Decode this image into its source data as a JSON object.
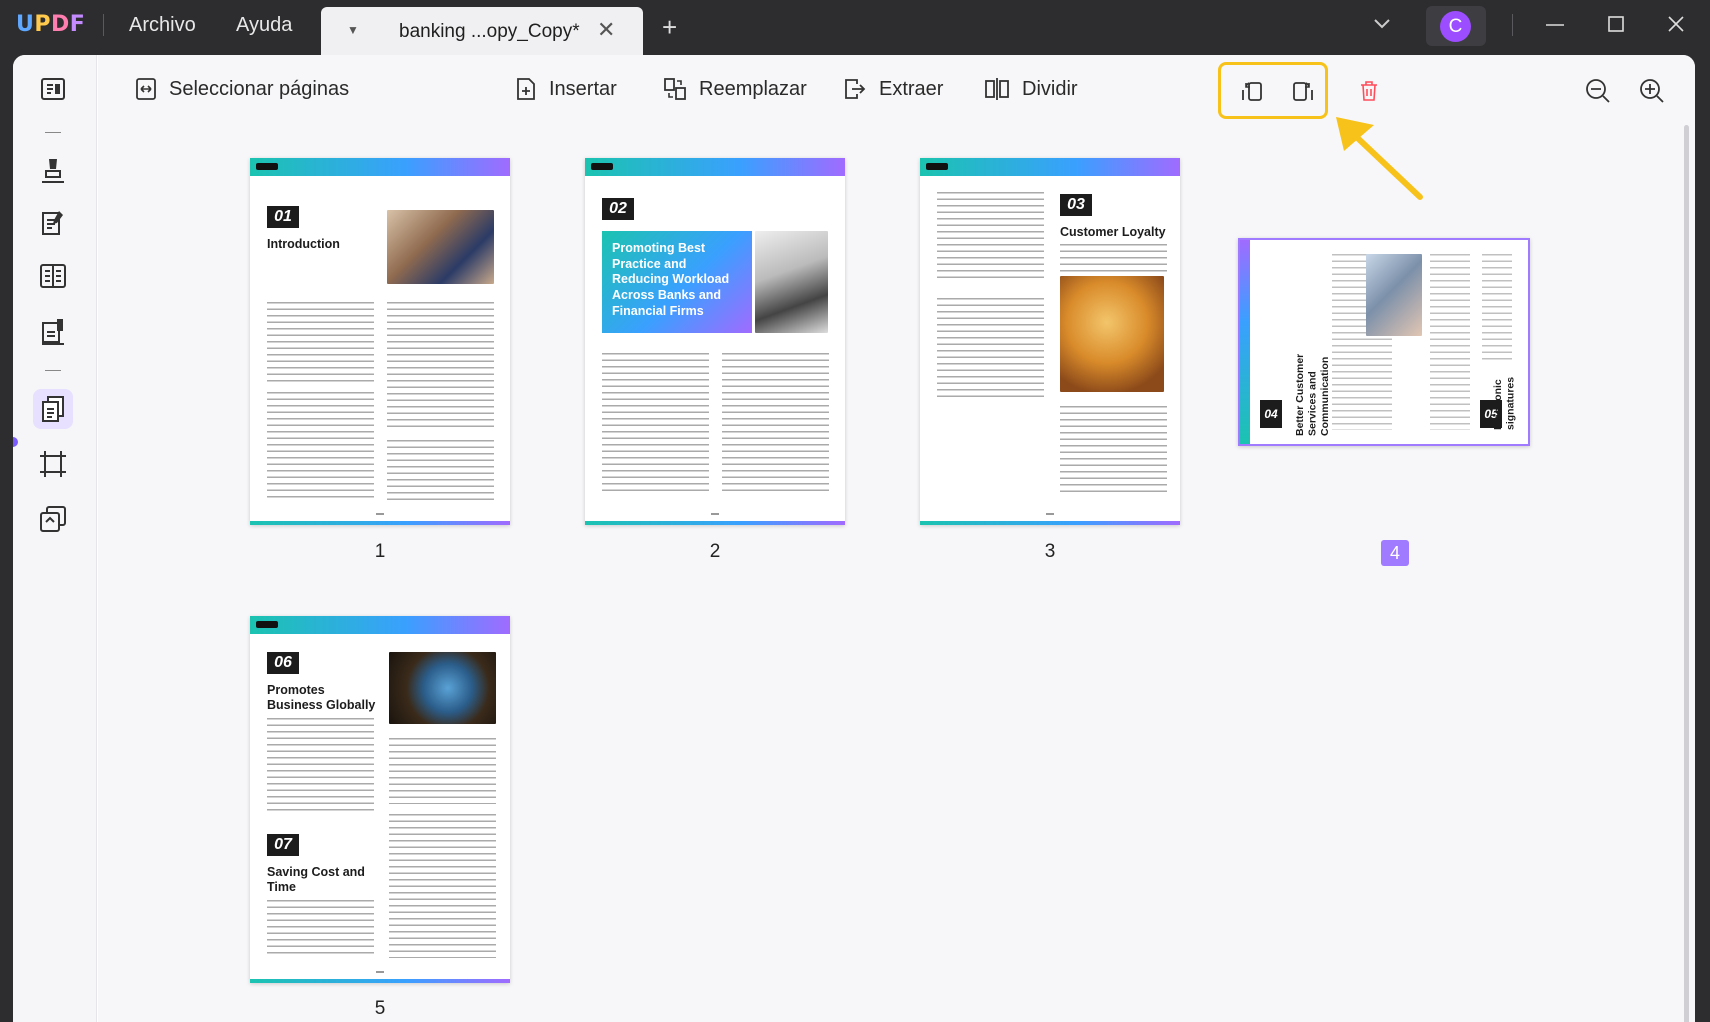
{
  "app": {
    "name_u": "U",
    "name_p": "P",
    "name_d": "D",
    "name_f": "F"
  },
  "menu": {
    "archivo": "Archivo",
    "ayuda": "Ayuda"
  },
  "tab": {
    "title": "banking ...opy_Copy*"
  },
  "user": {
    "avatar_letter": "C"
  },
  "toolbar": {
    "select_pages": "Seleccionar páginas",
    "insert": "Insertar",
    "replace": "Reemplazar",
    "extract": "Extraer",
    "split": "Dividir"
  },
  "pages": [
    {
      "label": "1",
      "section": "01",
      "title": "Introduction"
    },
    {
      "label": "2",
      "section": "02",
      "title": "Promoting Best Practice and Reducing Workload Across Banks and Financial Firms"
    },
    {
      "label": "3",
      "section": "03",
      "title": "Customer Loyalty"
    },
    {
      "label": "4",
      "section_a": "04",
      "title_a": "Better Customer Services and Communication",
      "section_b": "05",
      "title_b": "Electronic signatures",
      "selected": true
    },
    {
      "label": "5",
      "section_a": "06",
      "title_a": "Promotes Business Globally",
      "section_b": "07",
      "title_b": "Saving Cost and Time"
    }
  ],
  "page_header_logo": "UPDF",
  "colors": {
    "accent": "#a07aff",
    "highlight": "#f7c21a",
    "titlebar": "#2d2d30",
    "delete": "#ff4d5a"
  }
}
